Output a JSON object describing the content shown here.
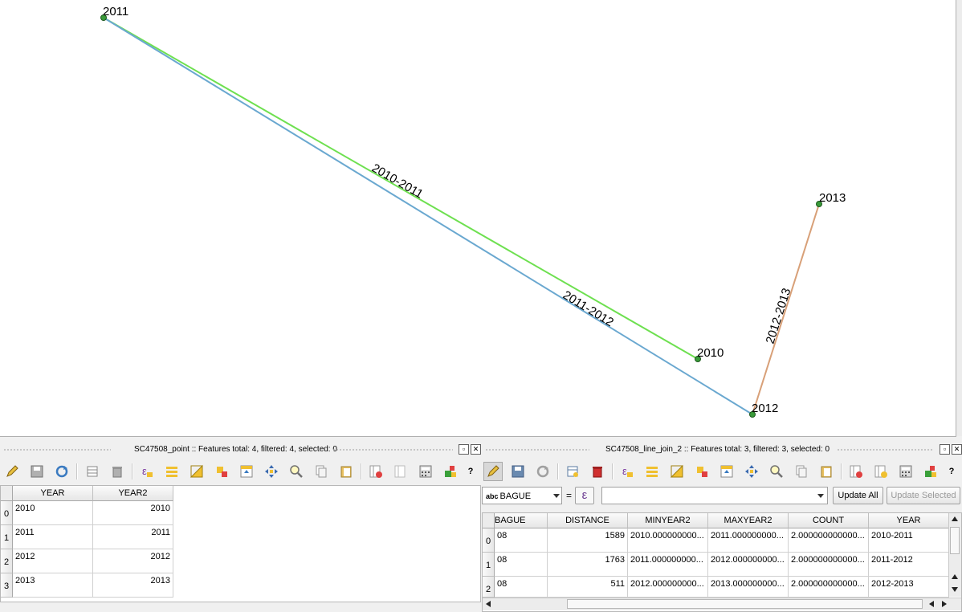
{
  "map": {
    "points": [
      {
        "label": "2011"
      },
      {
        "label": "2010"
      },
      {
        "label": "2012"
      },
      {
        "label": "2013"
      }
    ],
    "lines": [
      {
        "label": "2010-2011",
        "color": "#6ee050"
      },
      {
        "label": "2011-2012",
        "color": "#6aa8d0"
      },
      {
        "label": "2012-2013",
        "color": "#d8a078"
      }
    ],
    "point_color": "#3a9a3a"
  },
  "left_panel": {
    "title": "SC47508_point :: Features total: 4, filtered: 4, selected: 0",
    "help": "?",
    "columns": [
      "YEAR",
      "YEAR2"
    ],
    "rows": [
      {
        "index": "0",
        "year": "2010",
        "year2": "2010"
      },
      {
        "index": "1",
        "year": "2011",
        "year2": "2011"
      },
      {
        "index": "2",
        "year": "2012",
        "year2": "2012"
      },
      {
        "index": "3",
        "year": "2013",
        "year2": "2013"
      }
    ]
  },
  "right_panel": {
    "title": "SC47508_line_join_2 :: Features total: 3, filtered: 3, selected: 0",
    "help": "?",
    "field_type": "abc",
    "field_name": "BAGUE",
    "equals": "=",
    "epsilon": "ε",
    "update_all": "Update All",
    "update_selected": "Update Selected",
    "columns": [
      "BAGUE",
      "DISTANCE",
      "MINYEAR2",
      "MAXYEAR2",
      "COUNT",
      "YEAR"
    ],
    "rows": [
      {
        "index": "0",
        "bague": "08",
        "distance": "1589",
        "minyear2": "2010.000000000...",
        "maxyear2": "2011.000000000...",
        "count": "2.000000000000...",
        "year": "2010-2011"
      },
      {
        "index": "1",
        "bague": "08",
        "distance": "1763",
        "minyear2": "2011.000000000...",
        "maxyear2": "2012.000000000...",
        "count": "2.000000000000...",
        "year": "2011-2012"
      },
      {
        "index": "2",
        "bague": "08",
        "distance": "511",
        "minyear2": "2012.000000000...",
        "maxyear2": "2013.000000000...",
        "count": "2.000000000000...",
        "year": "2012-2013"
      }
    ]
  }
}
